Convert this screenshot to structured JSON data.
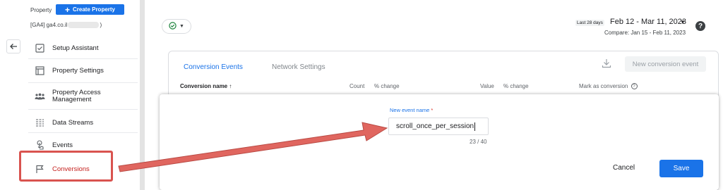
{
  "sidebar": {
    "property_label": "Property",
    "create_property_label": "Create Property",
    "account_prefix": "[GA4] ga4.co.il",
    "account_suffix": ")",
    "items": [
      {
        "label": "Setup Assistant",
        "icon": "checklist-icon"
      },
      {
        "label": "Property Settings",
        "icon": "settings-panel-icon"
      },
      {
        "label": "Property Access Management",
        "icon": "people-icon"
      },
      {
        "label": "Data Streams",
        "icon": "data-streams-icon"
      },
      {
        "label": "Events",
        "icon": "touch-icon"
      },
      {
        "label": "Conversions",
        "icon": "flag-icon"
      }
    ],
    "active_color": "#c5221f"
  },
  "header": {
    "date_small": "Last 28 days",
    "date_range": "Feb 12 - Mar 11, 2023",
    "compare": "Compare: Jan 15 - Feb 11, 2023"
  },
  "card": {
    "tabs": [
      {
        "label": "Conversion Events",
        "active": true
      },
      {
        "label": "Network Settings",
        "active": false
      }
    ],
    "new_conversion_label": "New conversion event",
    "columns": {
      "name": "Conversion name ↑",
      "count": "Count",
      "count_change": "% change",
      "value": "Value",
      "value_change": "% change",
      "mark": "Mark as conversion"
    }
  },
  "panel": {
    "field_label": "New event name",
    "required_mark": "*",
    "field_value": "scroll_once_per_session",
    "counter": "23 / 40",
    "cancel_label": "Cancel",
    "save_label": "Save"
  },
  "colors": {
    "accent": "#1a73e8",
    "highlight": "#d9534f"
  }
}
